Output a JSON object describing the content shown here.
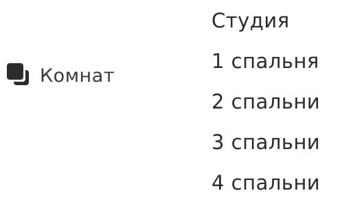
{
  "rooms_filter": {
    "label": "Комнат",
    "icon": "rooms-icon",
    "options": [
      {
        "label": "Студия"
      },
      {
        "label": "1 спальня"
      },
      {
        "label": "2 спальни"
      },
      {
        "label": "3 спальни"
      },
      {
        "label": "4 спальни"
      }
    ]
  }
}
